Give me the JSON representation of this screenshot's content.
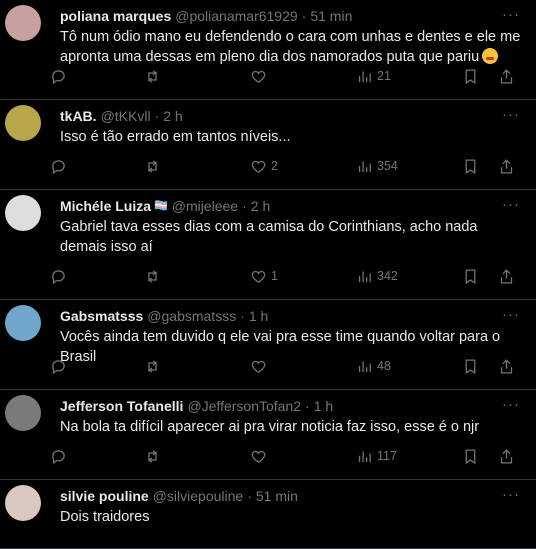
{
  "tweets": [
    {
      "name": "poliana marques",
      "handle": "@polianamar61929",
      "time": "51 min",
      "text": "Tô num ódio mano eu defendendo o cara com unhas e dentes e ele me apronta uma dessas em pleno dia dos namorados puta que pariu",
      "emoji": "emoji-yawning-face",
      "replies": "",
      "retweets": "",
      "likes": "",
      "views": "21",
      "avatar_color": "#c9a0a0"
    },
    {
      "name": "tkAB.",
      "handle": "@tKKvll",
      "time": "2 h",
      "text": "Isso é tão errado em tantos níveis...",
      "replies": "",
      "retweets": "",
      "likes": "2",
      "views": "354",
      "avatar_color": "#b8a64a"
    },
    {
      "name": "Michéle Luiza",
      "name_suffix": "🏳‍⚧",
      "handle": "@mijeleee",
      "time": "2 h",
      "text": "Gabriel tava esses dias com a camisa do Corinthians, acho nada demais isso aí",
      "replies": "",
      "retweets": "",
      "likes": "1",
      "views": "342",
      "avatar_color": "#dddddd"
    },
    {
      "name": "Gabsmatsss",
      "handle": "@gabsmatsss",
      "time": "1 h",
      "text": "Vocês ainda tem duvido q ele vai pra esse time quando voltar para o Brasil",
      "replies": "",
      "retweets": "",
      "likes": "",
      "views": "48",
      "avatar_color": "#6fa6c9"
    },
    {
      "name": "Jefferson Tofanelli",
      "handle": "@JeffersonTofan2",
      "time": "1 h",
      "text": "Na bola ta difícil aparecer ai pra virar noticia faz isso, esse é o njr",
      "replies": "",
      "retweets": "",
      "likes": "",
      "views": "117",
      "avatar_color": "#7a7a7a"
    },
    {
      "name": "silvie pouline",
      "handle": "@silviepouline",
      "time": "51 min",
      "text": "Dois traidores",
      "replies": "",
      "retweets": "",
      "likes": "",
      "views": "",
      "avatar_color": "#d8c8c0"
    }
  ],
  "colors": {
    "background": "#000000",
    "text": "#e7e9ea",
    "muted": "#71767b",
    "divider": "#2f3336"
  },
  "icons": [
    "reply-icon",
    "retweet-icon",
    "like-icon",
    "views-icon",
    "bookmark-icon",
    "share-icon",
    "more-icon"
  ]
}
